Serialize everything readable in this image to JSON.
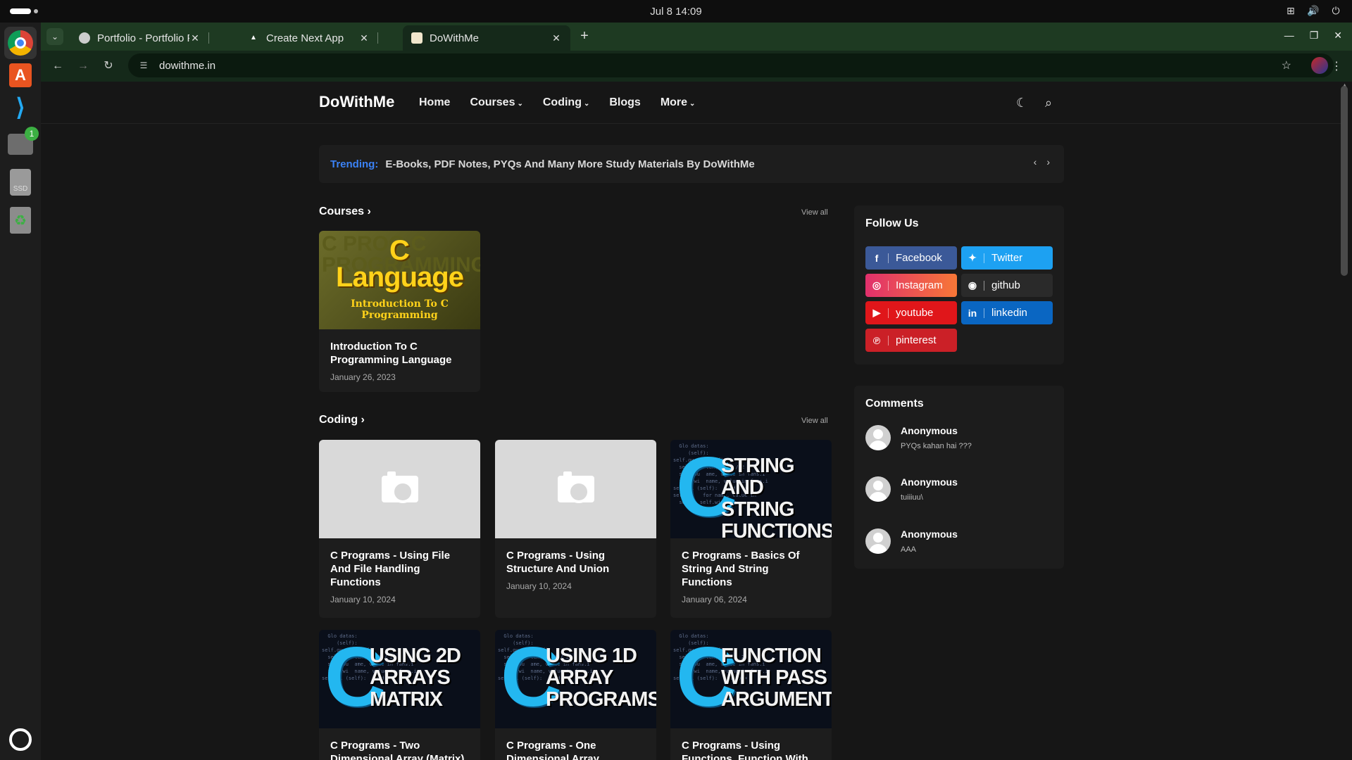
{
  "system": {
    "clock": "Jul 8  14:09"
  },
  "browser": {
    "tabs": [
      {
        "title": "Portfolio - Portfolio Platf"
      },
      {
        "title": "Create Next App"
      },
      {
        "title": "DoWithMe"
      }
    ],
    "url": "dowithme.in"
  },
  "site": {
    "logo": "DoWithMe",
    "nav": [
      "Home",
      "Courses",
      "Coding",
      "Blogs",
      "More"
    ],
    "trending_label": "Trending:",
    "trending_text": "E-Books, PDF Notes, PYQs And Many More Study Materials By DoWithMe",
    "courses_title": "Courses",
    "coding_title": "Coding",
    "view_all": "View all",
    "courses": [
      {
        "title": "Introduction To C Programming Language",
        "date": "January 26, 2023",
        "thumb_big1": "C",
        "thumb_big2": "Language",
        "thumb_small": "Introduction To C Programming"
      }
    ],
    "coding": [
      {
        "title": "C Programs - Using File And File Handling Functions",
        "date": "January 10, 2024"
      },
      {
        "title": "C Programs - Using Structure And Union",
        "date": "January 10, 2024"
      },
      {
        "title": "C Programs - Basics Of String And String Functions",
        "date": "January 06, 2024",
        "caption": "STRING AND STRING FUNCTIONS"
      },
      {
        "title": "C Programs - Two Dimensional Array (Matrix)",
        "caption": "USING 2D ARRAYS MATRIX"
      },
      {
        "title": "C Programs - One Dimensional Array",
        "caption": "USING 1D ARRAY PROGRAMS"
      },
      {
        "title": "C Programs - Using Functions, Function With",
        "caption": "FUNCTION WITH PASS ARGUMENTS"
      }
    ],
    "follow_title": "Follow Us",
    "social": [
      {
        "label": "Facebook",
        "icon": "facebook-icon",
        "color": "#3b5998"
      },
      {
        "label": "Twitter",
        "icon": "twitter-icon",
        "color": "#1da1f2"
      },
      {
        "label": "Instagram",
        "icon": "instagram-icon",
        "color": "#d6306e"
      },
      {
        "label": "github",
        "icon": "github-icon",
        "color": "#2a2a2a"
      },
      {
        "label": "youtube",
        "icon": "youtube-icon",
        "color": "#e0161a"
      },
      {
        "label": "linkedin",
        "icon": "linkedin-icon",
        "color": "#0a66c2"
      },
      {
        "label": "pinterest",
        "icon": "pinterest-icon",
        "color": "#cb2027"
      }
    ],
    "comments_title": "Comments",
    "comments": [
      {
        "name": "Anonymous",
        "text": "PYQs kahan hai ???"
      },
      {
        "name": "Anonymous",
        "text": "tuiiiuu\\"
      },
      {
        "name": "Anonymous",
        "text": "AAA"
      }
    ]
  }
}
